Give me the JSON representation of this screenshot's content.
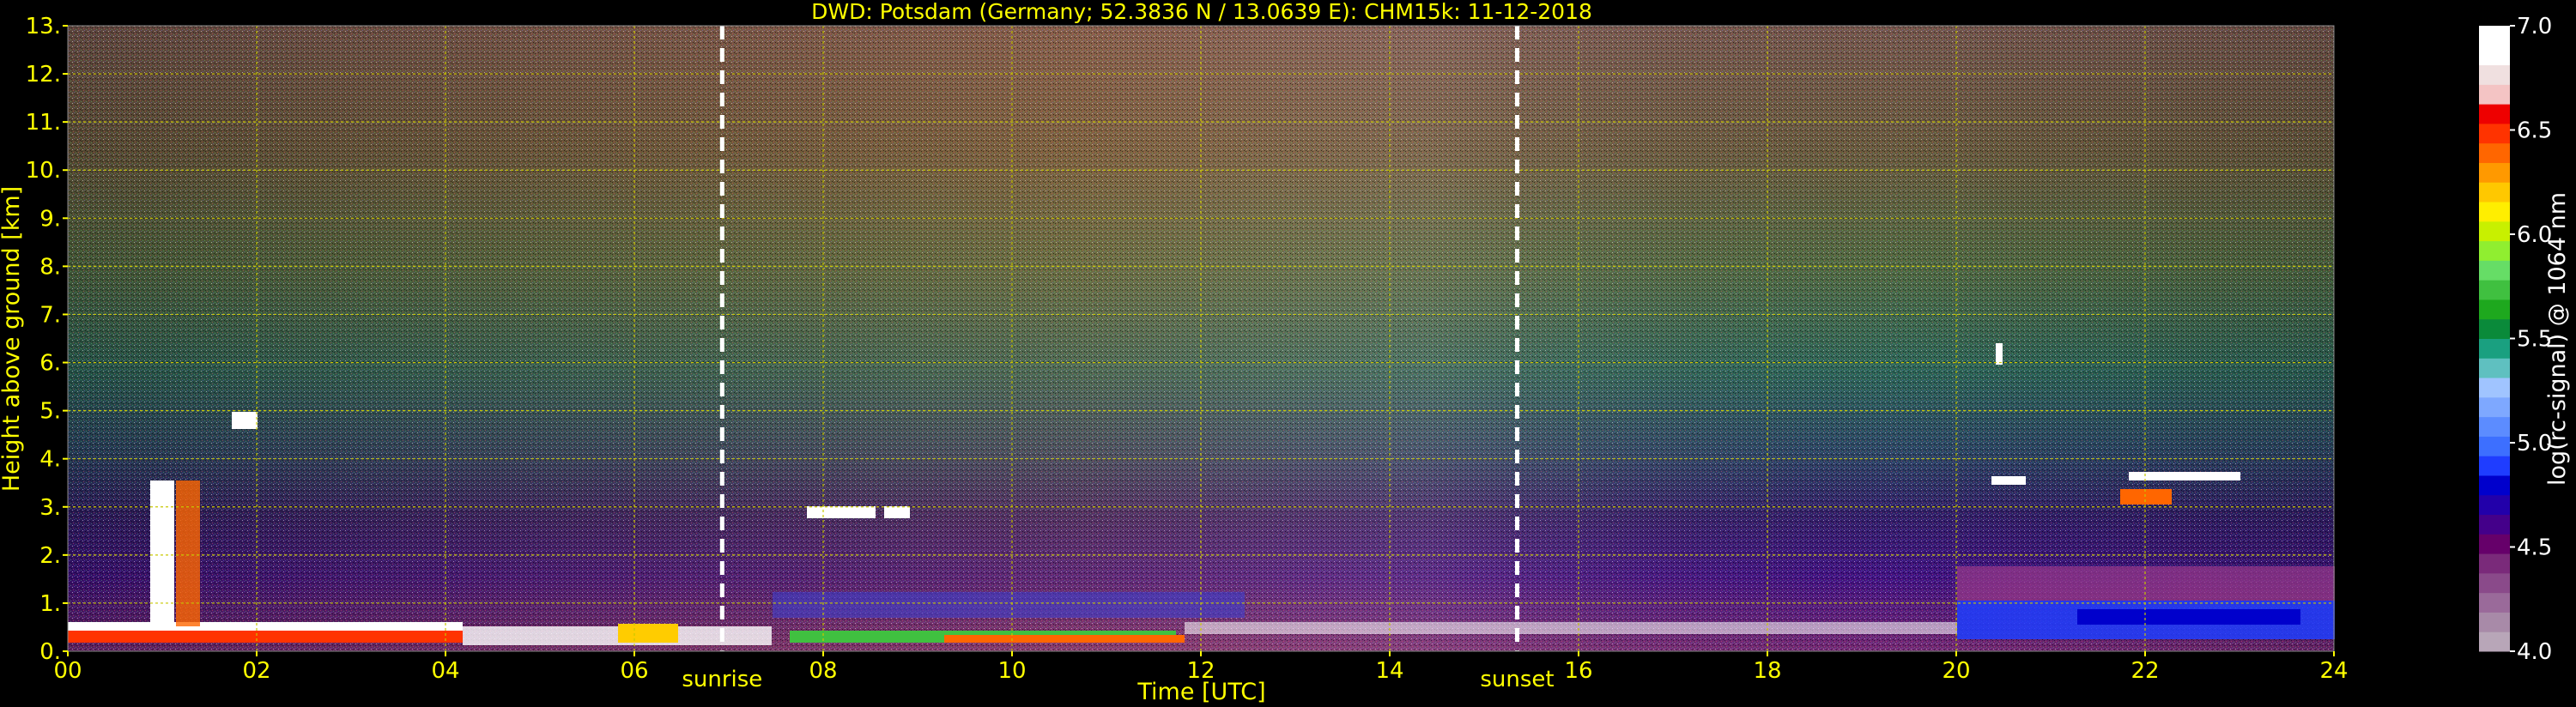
{
  "chart_data": {
    "type": "heatmap",
    "title": "DWD: Potsdam (Germany; 52.3836 N / 13.0639 E):    CHM15k: 11-12-2018",
    "xlabel": "Time [UTC]",
    "ylabel": "Height above ground [km]",
    "x_ticks": [
      "00",
      "02",
      "04",
      "06",
      "08",
      "10",
      "12",
      "14",
      "16",
      "18",
      "20",
      "22",
      "24"
    ],
    "y_ticks": [
      "0.",
      "1.",
      "2.",
      "3.",
      "4.",
      "5.",
      "6.",
      "7.",
      "8.",
      "9.",
      "10.",
      "11.",
      "12.",
      "13."
    ],
    "xlim": [
      0,
      24
    ],
    "ylim": [
      0,
      13
    ],
    "grid": true,
    "colorbar": {
      "label": "log(rc-signal) @ 1064 nm",
      "ticks": [
        "4.0",
        "4.5",
        "5.0",
        "5.5",
        "6.0",
        "6.5",
        "7.0"
      ],
      "range": [
        4.0,
        7.0
      ],
      "colors": [
        "#b8a6b8",
        "#a88aa8",
        "#9a6a9a",
        "#8a4a8a",
        "#7a2a7a",
        "#66006a",
        "#44008a",
        "#2200aa",
        "#0000cc",
        "#1f3dff",
        "#3d6fff",
        "#5c8cff",
        "#7ea8ff",
        "#a0c4ff",
        "#5fc0c0",
        "#1aa080",
        "#0a8a3a",
        "#1ea81e",
        "#40c040",
        "#66dd66",
        "#90ee30",
        "#c8f000",
        "#ffee00",
        "#ffc800",
        "#ff9900",
        "#ff6600",
        "#ff3300",
        "#ee0000",
        "#f4c4c4",
        "#f0e0e0",
        "#ffffff",
        "#ffffff"
      ]
    },
    "markers": [
      {
        "label": "sunrise",
        "x": 6.93
      },
      {
        "label": "sunset",
        "x": 15.35
      }
    ],
    "colors": {
      "text": "#ffff00",
      "grid": "#c8c800",
      "background": "#000000"
    }
  }
}
